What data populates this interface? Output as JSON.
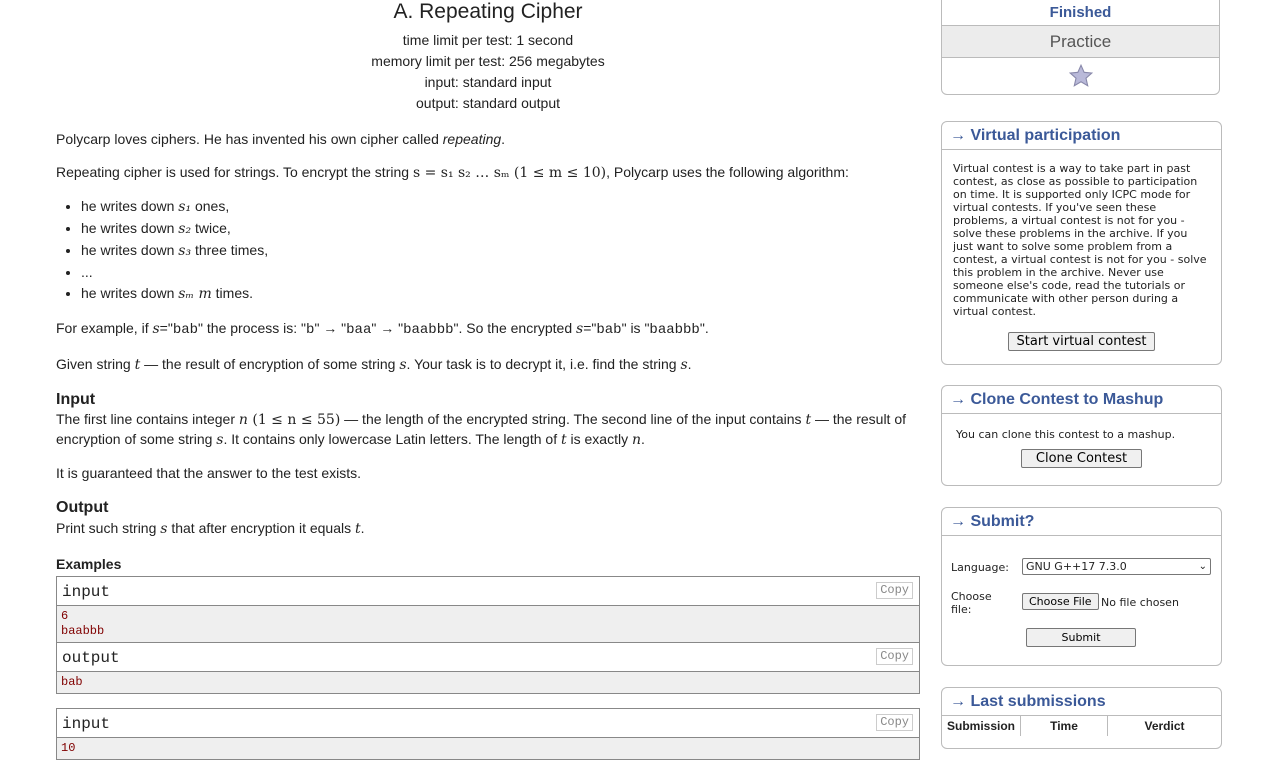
{
  "problem": {
    "title": "A. Repeating Cipher",
    "time_limit": "time limit per test: 1 second",
    "memory_limit": "memory limit per test: 256 megabytes",
    "input": "input: standard input",
    "output": "output: standard output",
    "p1_a": "Polycarp loves ciphers. He has invented his own cipher called ",
    "p1_em": "repeating",
    "p1_b": ".",
    "p2_a": "Repeating cipher is used for strings. To encrypt the string ",
    "p2_math": "s = s₁ s₂ … sₘ (1 ≤ m ≤ 10)",
    "p2_b": ", Polycarp uses the following algorithm:",
    "list": [
      {
        "pre": "he writes down ",
        "var": "s₁",
        "post": " ones,"
      },
      {
        "pre": "he writes down ",
        "var": "s₂",
        "post": " twice,"
      },
      {
        "pre": "he writes down ",
        "var": "s₃",
        "post": " three times,"
      },
      {
        "pre": "...",
        "var": "",
        "post": ""
      },
      {
        "pre": "he writes down ",
        "var": "sₘ m",
        "post": " times."
      }
    ],
    "p3_a": "For example, if ",
    "p3_s": "s",
    "p3_b": "=\"",
    "p3_c": "bab",
    "p3_d": "\" the process is: \"",
    "p3_e": "b",
    "p3_f": "\" → \"",
    "p3_g": "baa",
    "p3_h": "\" → \"",
    "p3_i": "baabbb",
    "p3_j": "\". So the encrypted ",
    "p3_k": "s",
    "p3_l": "=\"",
    "p3_m": "bab",
    "p3_n": "\" is \"",
    "p3_o": "baabbb",
    "p3_p": "\".",
    "p4_a": "Given string ",
    "p4_t": "t",
    "p4_b": " — the result of encryption of some string ",
    "p4_s": "s",
    "p4_c": ". Your task is to decrypt it, i.e. find the string ",
    "p4_s2": "s",
    "p4_d": ".",
    "input_h": "Input",
    "in_a": "The first line contains integer ",
    "in_n": "n",
    "in_range": " (1 ≤ n ≤ 55)",
    "in_b": " — the length of the encrypted string. The second line of the input contains ",
    "in_t": "t",
    "in_c": " — the result of encryption of some string ",
    "in_s": "s",
    "in_d": ". It contains only lowercase Latin letters. The length of ",
    "in_t2": "t",
    "in_e": " is exactly ",
    "in_n2": "n",
    "in_f": ".",
    "guarantee": "It is guaranteed that the answer to the test exists.",
    "output_h": "Output",
    "out_a": "Print such string ",
    "out_s": "s",
    "out_b": " that after encryption it equals ",
    "out_t": "t",
    "out_c": ".",
    "examples_h": "Examples",
    "examples": [
      {
        "label": "input",
        "copy": "Copy",
        "lines": [
          "6",
          "baabbb"
        ]
      },
      {
        "label": "output",
        "copy": "Copy",
        "lines": [
          "bab"
        ]
      },
      {
        "label": "input",
        "copy": "Copy",
        "lines": [
          "10"
        ]
      }
    ]
  },
  "sidebar": {
    "status": "Finished",
    "practice": "Practice",
    "virtual": {
      "title": "→ Virtual participation",
      "text": "Virtual contest is a way to take part in past contest, as close as possible to participation on time. It is supported only ICPC mode for virtual contests. If you've seen these problems, a virtual contest is not for you - solve these problems in the archive. If you just want to solve some problem from a contest, a virtual contest is not for you - solve this problem in the archive. Never use someone else's code, read the tutorials or communicate with other person during a virtual contest.",
      "button": "Start virtual contest"
    },
    "clone": {
      "title": "→ Clone Contest to Mashup",
      "text": "You can clone this contest to a mashup.",
      "button": "Clone Contest"
    },
    "submit": {
      "title": "→ Submit?",
      "language_label": "Language:",
      "language_value": "GNU G++17 7.3.0",
      "file_label": "Choose file:",
      "file_button": "Choose File",
      "file_status": "No file chosen",
      "button": "Submit"
    },
    "last": {
      "title": "→ Last submissions",
      "cols": [
        "Submission",
        "Time",
        "Verdict"
      ]
    }
  }
}
